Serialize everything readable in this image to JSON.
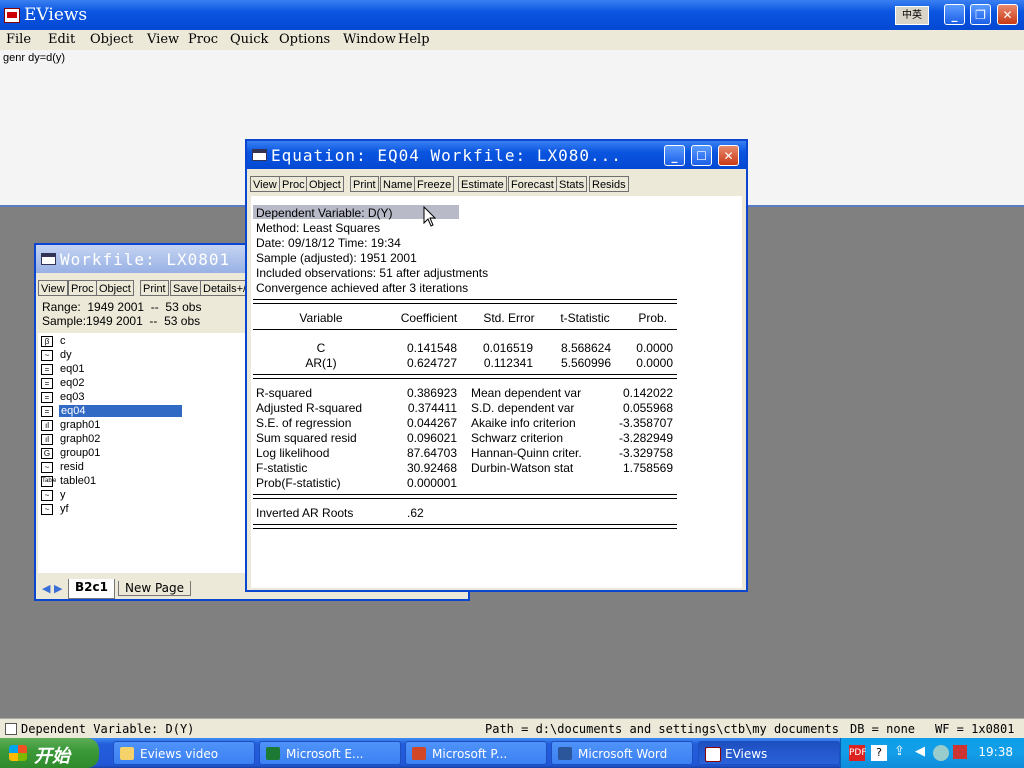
{
  "app": {
    "title": "EViews",
    "ime_badge": "中英"
  },
  "menu": [
    "File",
    "Edit",
    "Object",
    "View",
    "Proc",
    "Quick",
    "Options",
    "Window",
    "Help"
  ],
  "command": "genr dy=d(y)",
  "workfile": {
    "title": "Workfile: LX0801",
    "toolbar": [
      "View",
      "Proc",
      "Object",
      "Print",
      "Save",
      "Details+/"
    ],
    "range_label": "Range:",
    "range_value": "1949 2001  --  53 obs",
    "sample_label": "Sample:",
    "sample_value": "1949 2001  --  53 obs",
    "objects": [
      {
        "name": "c",
        "icon": "β",
        "kind": "coef"
      },
      {
        "name": "dy",
        "icon": "~",
        "kind": "series"
      },
      {
        "name": "eq01",
        "icon": "=",
        "kind": "equation"
      },
      {
        "name": "eq02",
        "icon": "=",
        "kind": "equation"
      },
      {
        "name": "eq03",
        "icon": "=",
        "kind": "equation"
      },
      {
        "name": "eq04",
        "icon": "=",
        "kind": "equation",
        "selected": true
      },
      {
        "name": "graph01",
        "icon": "ıl",
        "kind": "graph"
      },
      {
        "name": "graph02",
        "icon": "ıl",
        "kind": "graph"
      },
      {
        "name": "group01",
        "icon": "G",
        "kind": "group"
      },
      {
        "name": "resid",
        "icon": "~",
        "kind": "series"
      },
      {
        "name": "table01",
        "icon": "Table",
        "kind": "table"
      },
      {
        "name": "y",
        "icon": "~",
        "kind": "series"
      },
      {
        "name": "yf",
        "icon": "~",
        "kind": "series"
      }
    ],
    "tabs": [
      "B2c1",
      "New Page"
    ]
  },
  "equation": {
    "title": "Equation: EQ04   Workfile: LX080...",
    "toolbar": [
      "View",
      "Proc",
      "Object",
      "Print",
      "Name",
      "Freeze",
      "Estimate",
      "Forecast",
      "Stats",
      "Resids"
    ],
    "header": [
      "Dependent Variable: D(Y)",
      "Method: Least Squares",
      "Date: 09/18/12   Time: 19:34",
      "Sample (adjusted): 1951 2001",
      "Included observations: 51 after adjustments",
      "Convergence achieved after 3 iterations"
    ],
    "columns": [
      "Variable",
      "Coefficient",
      "Std. Error",
      "t-Statistic",
      "Prob."
    ],
    "rows": [
      [
        "C",
        "0.141548",
        "0.016519",
        "8.568624",
        "0.0000"
      ],
      [
        "AR(1)",
        "0.624727",
        "0.112341",
        "5.560996",
        "0.0000"
      ]
    ],
    "stats": [
      [
        "R-squared",
        "0.386923",
        "Mean dependent var",
        "0.142022"
      ],
      [
        "Adjusted R-squared",
        "0.374411",
        "S.D. dependent var",
        "0.055968"
      ],
      [
        "S.E. of regression",
        "0.044267",
        "Akaike info criterion",
        "-3.358707"
      ],
      [
        "Sum squared resid",
        "0.096021",
        "Schwarz criterion",
        "-3.282949"
      ],
      [
        "Log likelihood",
        "87.64703",
        "Hannan-Quinn criter.",
        "-3.329758"
      ],
      [
        "F-statistic",
        "30.92468",
        "Durbin-Watson stat",
        "1.758569"
      ],
      [
        "Prob(F-statistic)",
        "0.000001",
        "",
        ""
      ]
    ],
    "roots_label": "Inverted AR Roots",
    "roots_value": ".62"
  },
  "status": {
    "left": "Dependent Variable: D(Y)",
    "path": "Path = d:\\documents and settings\\ctb\\my documents",
    "db": "DB = none",
    "wf": "WF = 1x0801"
  },
  "taskbar": {
    "start": "开始",
    "items": [
      "Eviews video",
      "Microsoft E...",
      "Microsoft P...",
      "Microsoft Word",
      "EViews"
    ],
    "clock": "19:38"
  },
  "colors": {
    "accent": "#0a55e0",
    "selection": "#316ac5",
    "taskbar": "#245edb",
    "start": "#3c9a3a"
  }
}
